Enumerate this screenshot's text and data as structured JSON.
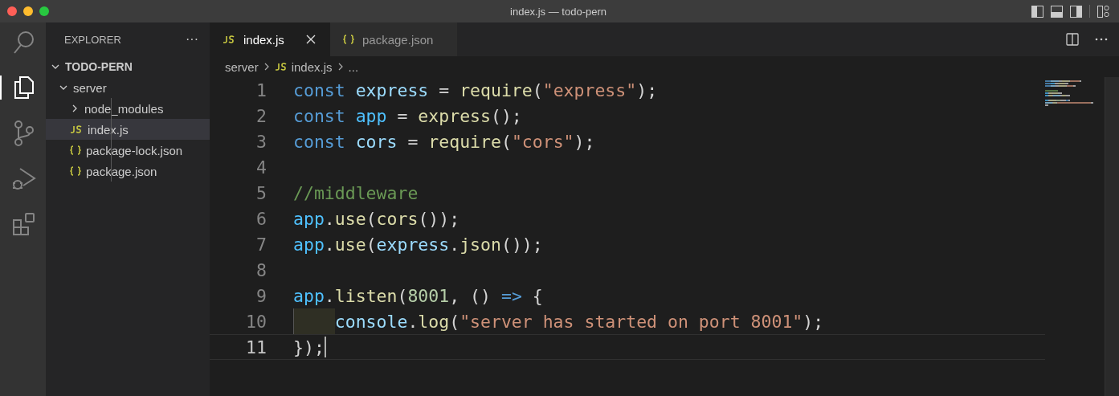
{
  "window": {
    "title": "index.js — todo-pern"
  },
  "activity_bar": [
    {
      "kind": "search",
      "selected": false
    },
    {
      "kind": "files",
      "selected": true
    },
    {
      "kind": "source-control",
      "selected": false
    },
    {
      "kind": "run",
      "selected": false
    },
    {
      "kind": "extensions",
      "selected": false
    }
  ],
  "sidebar": {
    "title": "EXPLORER",
    "more": "···",
    "root": {
      "label": "TODO-PERN",
      "expanded": true,
      "children": [
        {
          "label": "server",
          "kind": "folder",
          "expanded": true,
          "selected": false,
          "children": [
            {
              "label": "node_modules",
              "kind": "folder",
              "expanded": false,
              "selected": false
            },
            {
              "label": "index.js",
              "kind": "js",
              "selected": true
            },
            {
              "label": "package-lock.json",
              "kind": "json",
              "selected": false
            },
            {
              "label": "package.json",
              "kind": "json",
              "selected": false
            }
          ]
        }
      ]
    }
  },
  "tabs": [
    {
      "label": "index.js",
      "kind": "js",
      "selected": true
    },
    {
      "label": "package.json",
      "kind": "json",
      "selected": false
    }
  ],
  "breadcrumb": [
    {
      "label": "server",
      "kind": "folder"
    },
    {
      "label": "index.js",
      "kind": "js"
    },
    {
      "label": "...",
      "kind": "more"
    }
  ],
  "editor": {
    "lines": [
      {
        "number": "1",
        "current": false,
        "indent_highlight": false,
        "tokens": [
          {
            "text": "const",
            "kind": "keyword"
          },
          {
            "text": " express",
            "kind": "var"
          },
          {
            "text": " = ",
            "kind": "plain"
          },
          {
            "text": "require",
            "kind": "func"
          },
          {
            "text": "(",
            "kind": "plain"
          },
          {
            "text": "\"express\"",
            "kind": "string"
          },
          {
            "text": ");",
            "kind": "plain"
          }
        ]
      },
      {
        "number": "2",
        "current": false,
        "indent_highlight": false,
        "tokens": [
          {
            "text": "const",
            "kind": "keyword"
          },
          {
            "text": " app",
            "kind": "const"
          },
          {
            "text": " = ",
            "kind": "plain"
          },
          {
            "text": "express",
            "kind": "func"
          },
          {
            "text": "();",
            "kind": "plain"
          }
        ]
      },
      {
        "number": "3",
        "current": false,
        "indent_highlight": false,
        "tokens": [
          {
            "text": "const",
            "kind": "keyword"
          },
          {
            "text": " cors",
            "kind": "var"
          },
          {
            "text": " = ",
            "kind": "plain"
          },
          {
            "text": "require",
            "kind": "func"
          },
          {
            "text": "(",
            "kind": "plain"
          },
          {
            "text": "\"cors\"",
            "kind": "string"
          },
          {
            "text": ");",
            "kind": "plain"
          }
        ]
      },
      {
        "number": "4",
        "current": false,
        "indent_highlight": false
      },
      {
        "number": "5",
        "current": false,
        "indent_highlight": false,
        "tokens": [
          {
            "text": "//middleware",
            "kind": "comment"
          }
        ]
      },
      {
        "number": "6",
        "current": false,
        "indent_highlight": false,
        "tokens": [
          {
            "text": "app",
            "kind": "const"
          },
          {
            "text": ".",
            "kind": "plain"
          },
          {
            "text": "use",
            "kind": "func"
          },
          {
            "text": "(",
            "kind": "plain"
          },
          {
            "text": "cors",
            "kind": "func"
          },
          {
            "text": "());",
            "kind": "plain"
          }
        ]
      },
      {
        "number": "7",
        "current": false,
        "indent_highlight": false,
        "tokens": [
          {
            "text": "app",
            "kind": "const"
          },
          {
            "text": ".",
            "kind": "plain"
          },
          {
            "text": "use",
            "kind": "func"
          },
          {
            "text": "(",
            "kind": "plain"
          },
          {
            "text": "express",
            "kind": "var"
          },
          {
            "text": ".",
            "kind": "plain"
          },
          {
            "text": "json",
            "kind": "func"
          },
          {
            "text": "());",
            "kind": "plain"
          }
        ]
      },
      {
        "number": "8",
        "current": false,
        "indent_highlight": false
      },
      {
        "number": "9",
        "current": false,
        "indent_highlight": false,
        "tokens": [
          {
            "text": "app",
            "kind": "const"
          },
          {
            "text": ".",
            "kind": "plain"
          },
          {
            "text": "listen",
            "kind": "func"
          },
          {
            "text": "(",
            "kind": "plain"
          },
          {
            "text": "8001",
            "kind": "number"
          },
          {
            "text": ", () ",
            "kind": "plain"
          },
          {
            "text": "=>",
            "kind": "keyword"
          },
          {
            "text": " {",
            "kind": "plain"
          }
        ]
      },
      {
        "number": "10",
        "current": false,
        "indent_highlight": true,
        "tokens": [
          {
            "text": "console",
            "kind": "var"
          },
          {
            "text": ".",
            "kind": "plain"
          },
          {
            "text": "log",
            "kind": "func"
          },
          {
            "text": "(",
            "kind": "plain"
          },
          {
            "text": "\"server has started on port 8001\"",
            "kind": "string"
          },
          {
            "text": ");",
            "kind": "plain"
          }
        ]
      },
      {
        "number": "11",
        "current": true,
        "indent_highlight": false,
        "tokens": [
          {
            "text": "});",
            "kind": "plain"
          }
        ]
      }
    ]
  }
}
